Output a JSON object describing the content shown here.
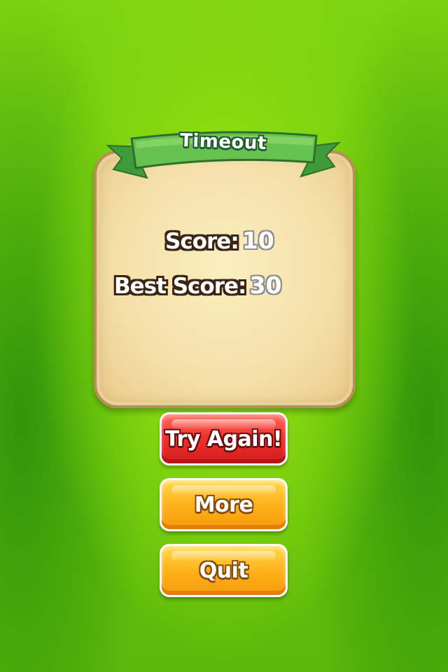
{
  "dialog": {
    "title": "Timeout",
    "score_label": "Score:",
    "score_value": "10",
    "best_label": "Best Score:",
    "best_value": "30"
  },
  "buttons": {
    "try_again": "Try Again!",
    "more": "More",
    "quit": "Quit"
  },
  "colors": {
    "background": "#7fd410",
    "panel": "#f4dfa8",
    "ribbon": "#5fb84a",
    "button_red": "#f0332c",
    "button_orange": "#ffb21c"
  }
}
